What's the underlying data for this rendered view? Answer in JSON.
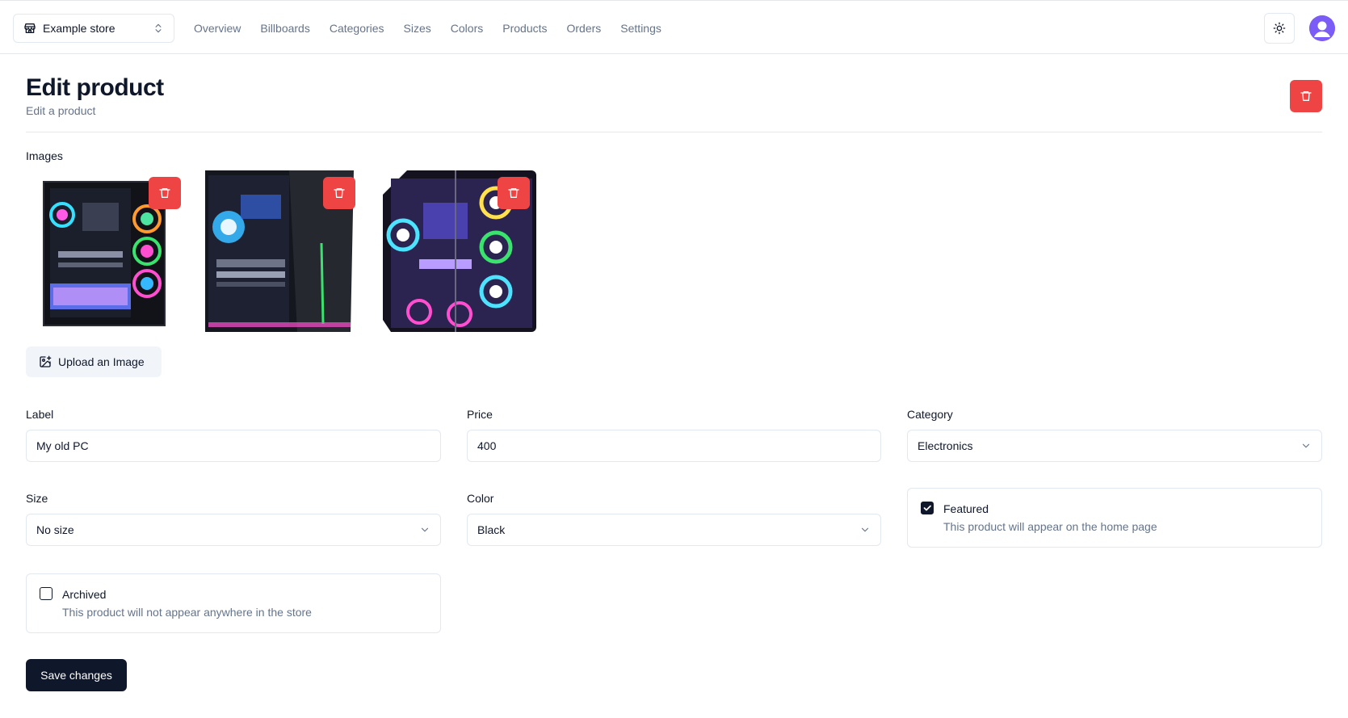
{
  "store_switcher": {
    "name": "Example store",
    "icon": "store-icon"
  },
  "nav": {
    "items": [
      "Overview",
      "Billboards",
      "Categories",
      "Sizes",
      "Colors",
      "Products",
      "Orders",
      "Settings"
    ]
  },
  "header": {
    "title": "Edit product",
    "subtitle": "Edit a product"
  },
  "images": {
    "label": "Images",
    "count": 3,
    "upload_label": "Upload an Image"
  },
  "form": {
    "label": {
      "label": "Label",
      "value": "My old PC"
    },
    "price": {
      "label": "Price",
      "value": "400"
    },
    "category": {
      "label": "Category",
      "value": "Electronics"
    },
    "size": {
      "label": "Size",
      "value": "No size"
    },
    "color": {
      "label": "Color",
      "value": "Black"
    },
    "featured": {
      "title": "Featured",
      "description": "This product will appear on the home page",
      "checked": true
    },
    "archived": {
      "title": "Archived",
      "description": "This product will not appear anywhere in the store",
      "checked": false
    },
    "save_label": "Save changes"
  },
  "colors": {
    "danger": "#ef4444",
    "primary": "#0f172a",
    "muted": "#64748b",
    "border": "#e2e8f0",
    "avatar": "#7c5cf6"
  }
}
